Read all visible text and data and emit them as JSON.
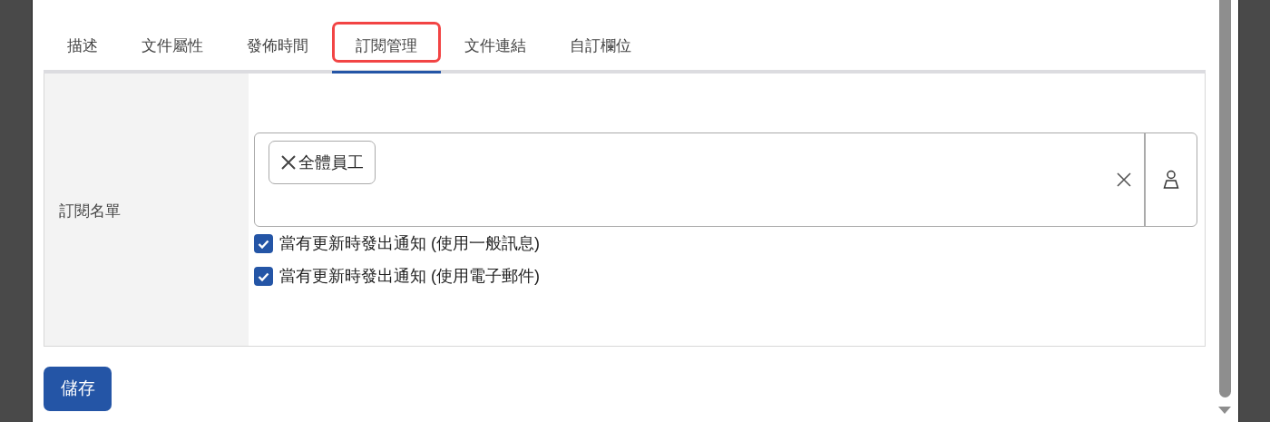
{
  "tabs": [
    {
      "label": "描述",
      "selected": false
    },
    {
      "label": "文件屬性",
      "selected": false
    },
    {
      "label": "發佈時間",
      "selected": false
    },
    {
      "label": "訂閱管理",
      "selected": true
    },
    {
      "label": "文件連結",
      "selected": false
    },
    {
      "label": "自訂欄位",
      "selected": false
    }
  ],
  "form": {
    "label": "訂閱名單",
    "tags": [
      {
        "label": "全體員工"
      }
    ],
    "options": [
      {
        "label": "當有更新時發出通知 (使用一般訊息)",
        "checked": true
      },
      {
        "label": "當有更新時發出通知 (使用電子郵件)",
        "checked": true
      }
    ]
  },
  "buttons": [
    {
      "label": "儲存"
    }
  ]
}
